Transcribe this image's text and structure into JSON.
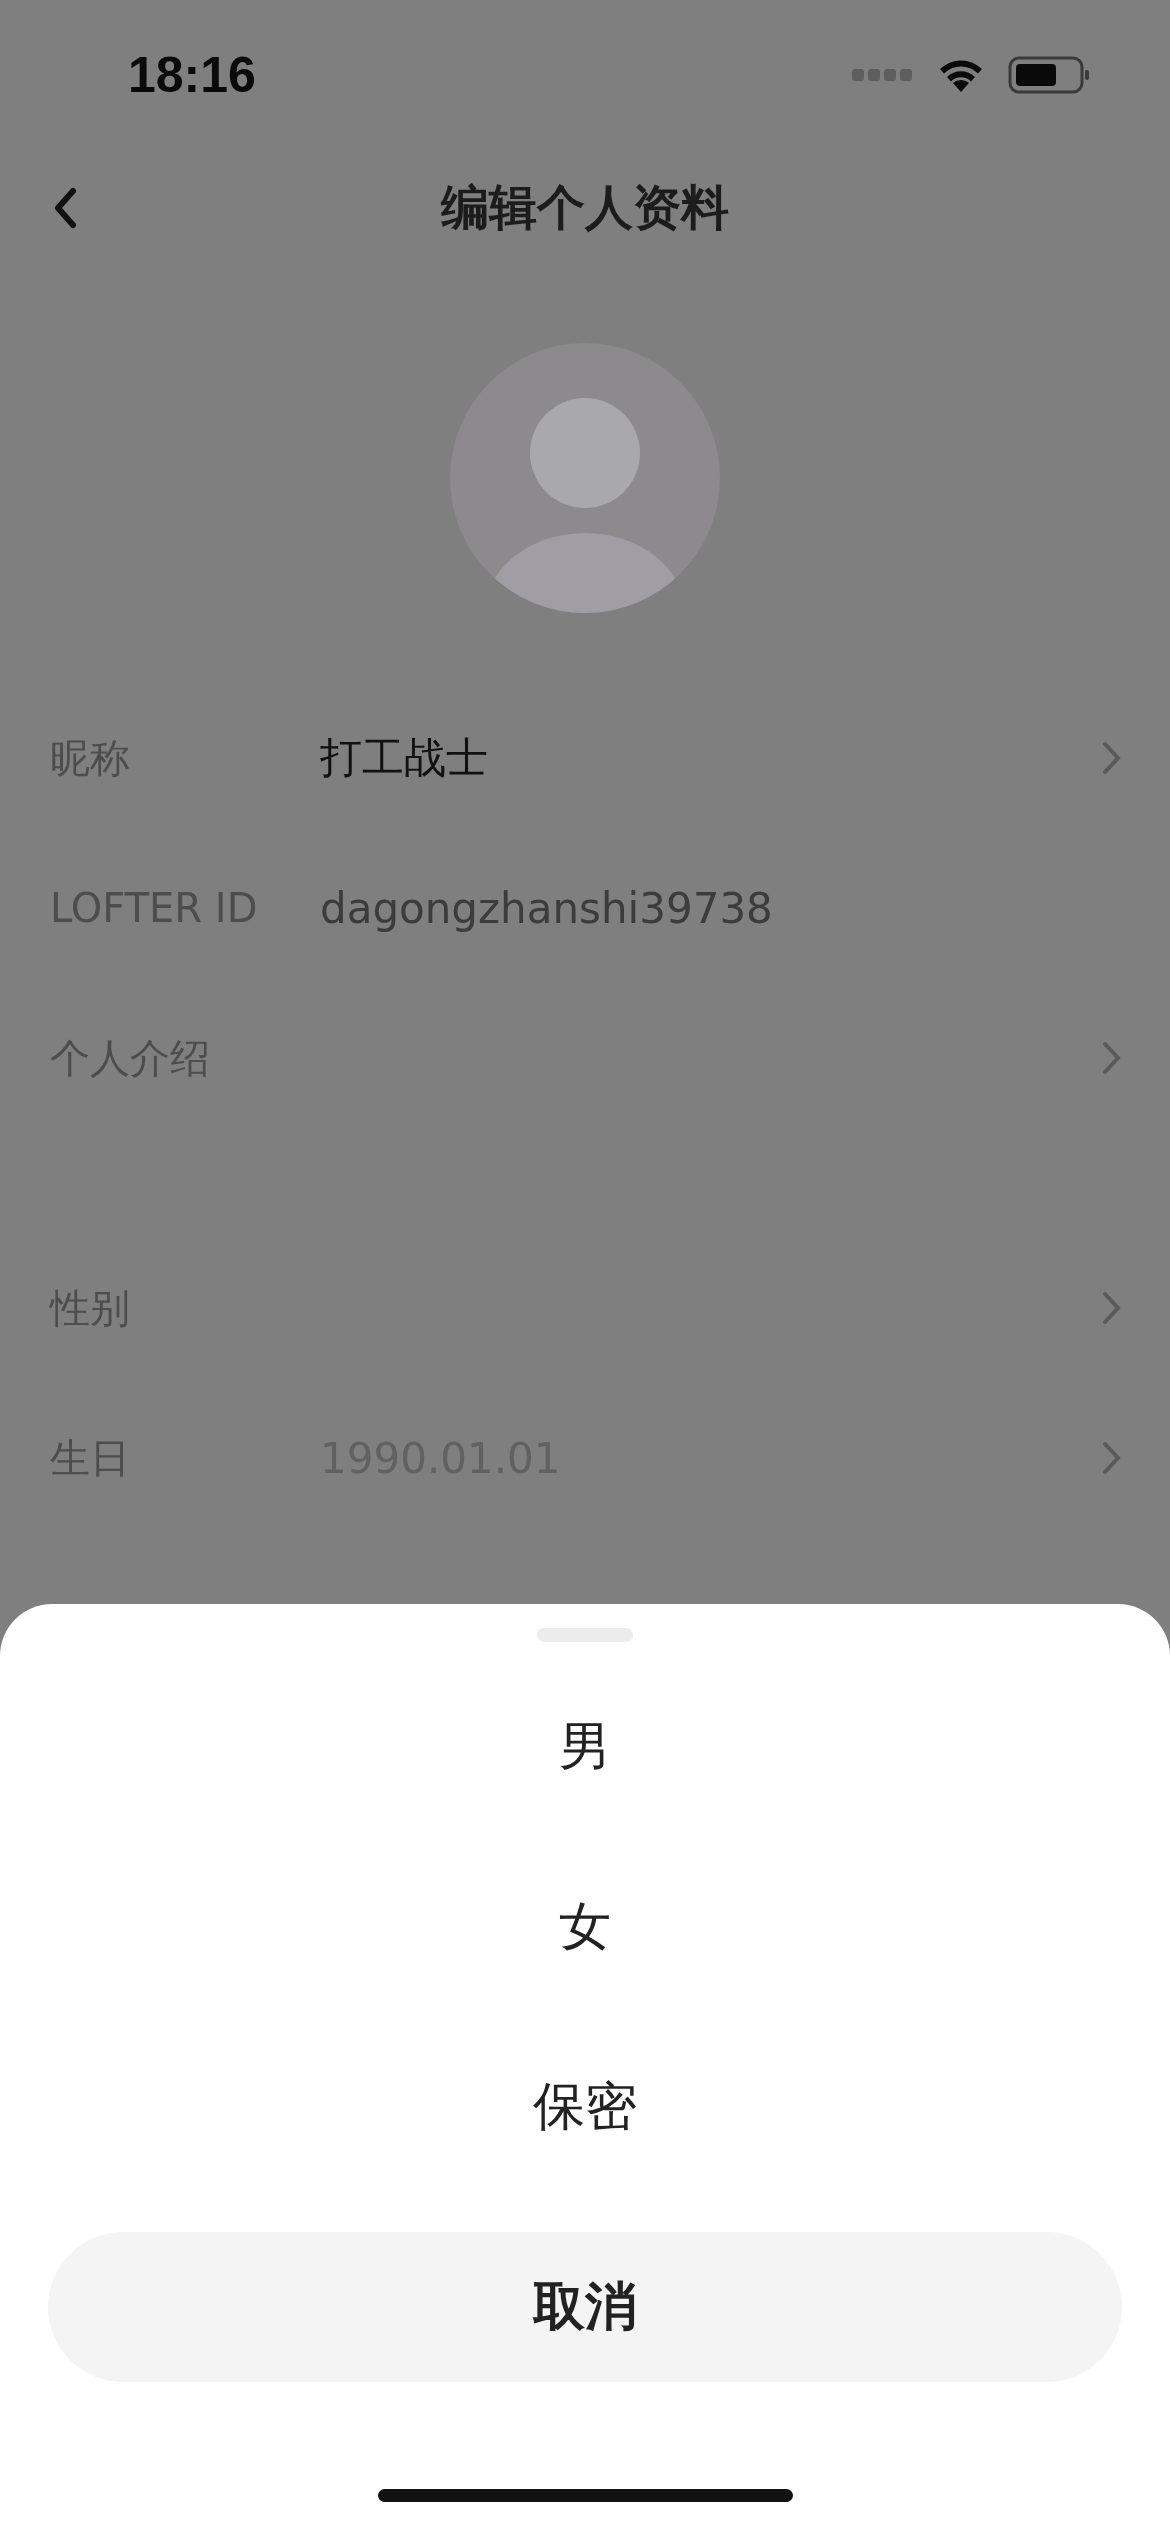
{
  "status_bar": {
    "time": "18:16"
  },
  "nav": {
    "title": "编辑个人资料"
  },
  "sections": [
    {
      "rows": [
        {
          "label": "昵称",
          "value": "打工战士",
          "muted": false,
          "chevron": true
        },
        {
          "label": "LOFTER ID",
          "value": "dagongzhanshi39738",
          "muted": true,
          "chevron": false
        },
        {
          "label": "个人介绍",
          "chevron": true
        }
      ]
    },
    {
      "rows": [
        {
          "label": "性别",
          "chevron": true
        },
        {
          "label": "生日",
          "placeholder": "1990.01.01",
          "chevron": true
        }
      ]
    }
  ],
  "sheet": {
    "options": [
      "男",
      "女",
      "保密"
    ],
    "cancel": "取消"
  }
}
